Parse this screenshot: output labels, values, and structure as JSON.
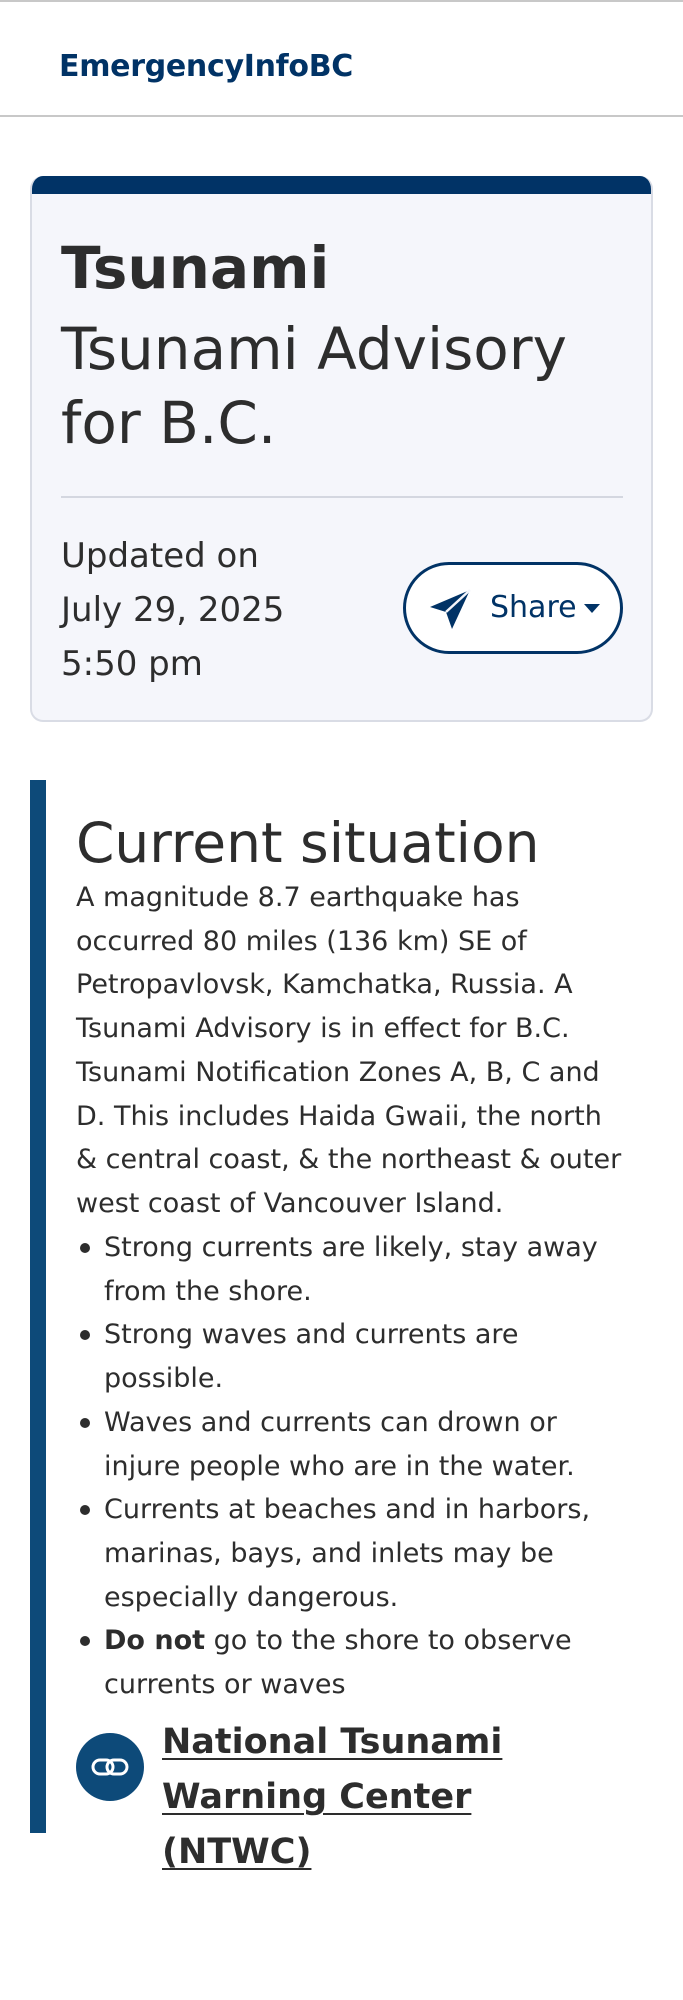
{
  "header": {
    "brand": "EmergencyInfoBC"
  },
  "alert": {
    "type": "Tsunami",
    "title": "Tsunami Advisory for B.C.",
    "updated_label": "Updated on",
    "updated_date": "July 29, 2025",
    "updated_time": "5:50 pm",
    "share_label": "Share",
    "share_icon": "paper-plane-icon"
  },
  "situation": {
    "heading": "Current situation",
    "body": "A magnitude 8.7 earthquake has occurred 80 miles (136 km) SE of Petropavlovsk, Kamchatka, Russia. A Tsunami Advisory is in effect for B.C. Tsunami Notification Zones A, B, C and D. This includes Haida Gwaii, the north & central coast, & the northeast & outer west coast of Vancouver Island.",
    "bullets": [
      "Strong currents are likely, stay away from the shore.",
      "Strong waves and currents are possible.",
      "Waves and currents can drown or injure people who are in the water.",
      "Currents at beaches and in harbors, marinas, bays, and inlets may be especially dangerous."
    ],
    "last_bullet_bold": "Do not",
    "last_bullet_rest": " go to the shore to observe currents or waves",
    "link_label": "National Tsunami Warning Center (NTWC)",
    "link_icon": "link-icon"
  },
  "colors": {
    "primary": "#013366",
    "accent_bar": "#0d4a79",
    "card_bg": "#f5f6fb",
    "text": "#2d2d2d"
  }
}
